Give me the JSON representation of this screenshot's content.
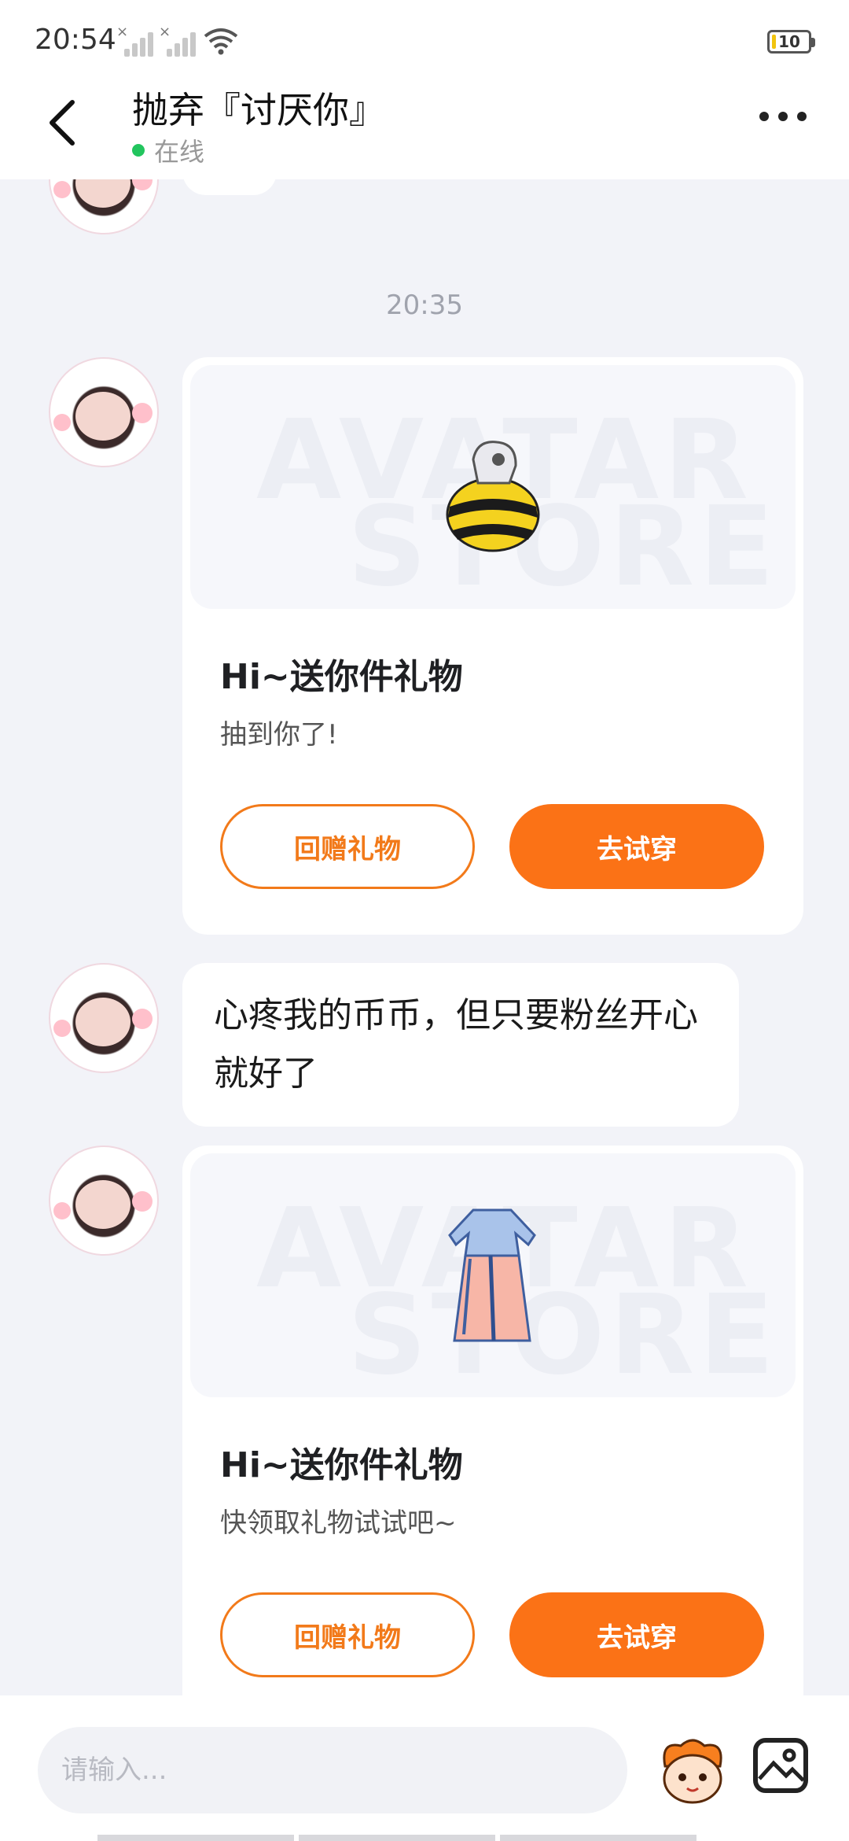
{
  "status_bar": {
    "time": "20:54",
    "battery": "10"
  },
  "header": {
    "title": "抛弃『讨厌你』",
    "status": "在线"
  },
  "chat": {
    "timestamp": "20:35",
    "messages": [
      {
        "type": "gift",
        "title": "Hi~送你件礼物",
        "subtitle": "抽到你了!",
        "watermark_line1": "AVATAR",
        "watermark_line2": "STORE",
        "item_icon": "bee-hat-icon",
        "return_label": "回赠礼物",
        "tryon_label": "去试穿"
      },
      {
        "type": "text",
        "text": "心疼我的币币，但只要粉丝开心就好了"
      },
      {
        "type": "gift",
        "title": "Hi~送你件礼物",
        "subtitle": "快领取礼物试试吧~",
        "watermark_line1": "AVATAR",
        "watermark_line2": "STORE",
        "item_icon": "hanfu-dress-icon",
        "return_label": "回赠礼物",
        "tryon_label": "去试穿"
      }
    ]
  },
  "input": {
    "placeholder": "请输入..."
  },
  "colors": {
    "accent": "#fb7216",
    "online": "#22c55e",
    "background": "#f2f3f8"
  }
}
